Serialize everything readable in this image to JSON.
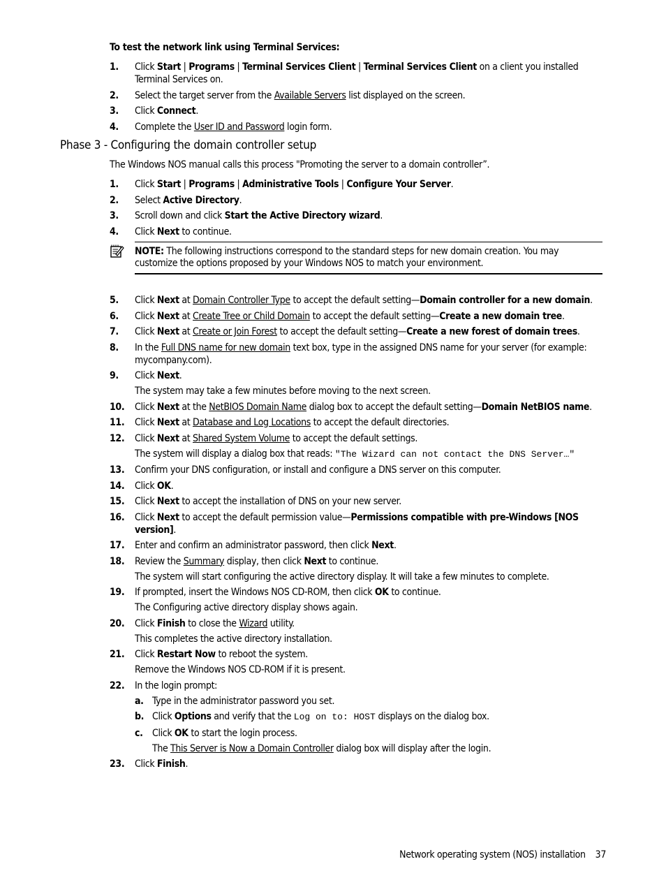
{
  "procedure_title": "To test the network link using Terminal Services:",
  "terminal_steps": [
    {
      "num": "1.",
      "paras": [
        [
          {
            "t": "Click "
          },
          {
            "t": "Start",
            "s": "b"
          },
          {
            "t": " | "
          },
          {
            "t": "Programs",
            "s": "b"
          },
          {
            "t": " | "
          },
          {
            "t": "Terminal Services Client",
            "s": "b"
          },
          {
            "t": " | "
          },
          {
            "t": "Terminal Services Client",
            "s": "b"
          },
          {
            "t": " on a client you installed Terminal Services on."
          }
        ]
      ]
    },
    {
      "num": "2.",
      "paras": [
        [
          {
            "t": "Select the target server from the "
          },
          {
            "t": "Available Servers",
            "s": "u"
          },
          {
            "t": " list displayed on the screen."
          }
        ]
      ]
    },
    {
      "num": "3.",
      "paras": [
        [
          {
            "t": "Click "
          },
          {
            "t": "Connect",
            "s": "b"
          },
          {
            "t": "."
          }
        ]
      ]
    },
    {
      "num": "4.",
      "paras": [
        [
          {
            "t": "Complete the "
          },
          {
            "t": "User ID and Password",
            "s": "u"
          },
          {
            "t": " login form."
          }
        ]
      ]
    }
  ],
  "section_heading": "Phase 3 - Configuring the domain controller setup",
  "intro": "The Windows NOS manual calls this process \"Promoting the server to a domain controller”.",
  "phase_steps_a": [
    {
      "num": "1.",
      "paras": [
        [
          {
            "t": "Click "
          },
          {
            "t": "Start",
            "s": "b"
          },
          {
            "t": " | "
          },
          {
            "t": "Programs",
            "s": "b"
          },
          {
            "t": " | "
          },
          {
            "t": "Administrative Tools",
            "s": "b"
          },
          {
            "t": " | "
          },
          {
            "t": "Configure Your Server",
            "s": "b"
          },
          {
            "t": "."
          }
        ]
      ]
    },
    {
      "num": "2.",
      "paras": [
        [
          {
            "t": "Select "
          },
          {
            "t": "Active Directory",
            "s": "b"
          },
          {
            "t": "."
          }
        ]
      ]
    },
    {
      "num": "3.",
      "paras": [
        [
          {
            "t": "Scroll down and click "
          },
          {
            "t": "Start the Active Directory wizard",
            "s": "b"
          },
          {
            "t": "."
          }
        ]
      ]
    },
    {
      "num": "4.",
      "paras": [
        [
          {
            "t": "Click "
          },
          {
            "t": "Next",
            "s": "b"
          },
          {
            "t": " to continue."
          }
        ]
      ]
    }
  ],
  "note": {
    "icon": "note-pad-icon",
    "label": "NOTE:",
    "text": " The following instructions correspond to the standard steps for new domain creation. You may customize the options proposed by your Windows NOS to match your environment."
  },
  "phase_steps_b": [
    {
      "num": "5.",
      "paras": [
        [
          {
            "t": "Click "
          },
          {
            "t": "Next",
            "s": "b"
          },
          {
            "t": " at "
          },
          {
            "t": "Domain Controller Type",
            "s": "u"
          },
          {
            "t": " to accept the default setting—"
          },
          {
            "t": "Domain controller for a new domain",
            "s": "b"
          },
          {
            "t": "."
          }
        ]
      ]
    },
    {
      "num": "6.",
      "paras": [
        [
          {
            "t": "Click "
          },
          {
            "t": "Next",
            "s": "b"
          },
          {
            "t": " at "
          },
          {
            "t": "Create Tree or Child Domain",
            "s": "u"
          },
          {
            "t": " to accept the default setting—"
          },
          {
            "t": "Create a new domain tree",
            "s": "b"
          },
          {
            "t": "."
          }
        ]
      ]
    },
    {
      "num": "7.",
      "paras": [
        [
          {
            "t": "Click "
          },
          {
            "t": "Next",
            "s": "b"
          },
          {
            "t": " at "
          },
          {
            "t": "Create or Join Forest",
            "s": "u"
          },
          {
            "t": " to accept the default setting—"
          },
          {
            "t": "Create a new forest of domain trees",
            "s": "b"
          },
          {
            "t": "."
          }
        ]
      ]
    },
    {
      "num": "8.",
      "paras": [
        [
          {
            "t": "In the "
          },
          {
            "t": "Full DNS name for new domain",
            "s": "u"
          },
          {
            "t": " text box, type in the assigned DNS name for your server (for example: mycompany.com)."
          }
        ]
      ]
    },
    {
      "num": "9.",
      "paras": [
        [
          {
            "t": "Click "
          },
          {
            "t": "Next",
            "s": "b"
          },
          {
            "t": "."
          }
        ],
        [
          {
            "t": "The system may take a few minutes before moving to the next screen."
          }
        ]
      ]
    },
    {
      "num": "10.",
      "paras": [
        [
          {
            "t": "Click "
          },
          {
            "t": "Next",
            "s": "b"
          },
          {
            "t": " at the "
          },
          {
            "t": "NetBIOS Domain Name",
            "s": "u"
          },
          {
            "t": " dialog box to accept the default setting—"
          },
          {
            "t": "Domain NetBIOS name",
            "s": "b"
          },
          {
            "t": "."
          }
        ]
      ]
    },
    {
      "num": "11.",
      "paras": [
        [
          {
            "t": "Click "
          },
          {
            "t": "Next",
            "s": "b"
          },
          {
            "t": " at "
          },
          {
            "t": "Database and Log Locations",
            "s": "u"
          },
          {
            "t": " to accept the default directories."
          }
        ]
      ]
    },
    {
      "num": "12.",
      "paras": [
        [
          {
            "t": "Click "
          },
          {
            "t": "Next",
            "s": "b"
          },
          {
            "t": " at "
          },
          {
            "t": "Shared System Volume",
            "s": "u"
          },
          {
            "t": " to accept the default settings."
          }
        ],
        [
          {
            "t": "The system will display a dialog box that reads: "
          },
          {
            "t": "\"The Wizard can not contact the DNS Server…\"",
            "s": "m"
          }
        ]
      ]
    },
    {
      "num": "13.",
      "paras": [
        [
          {
            "t": "Confirm your DNS configuration, or install and configure a DNS server on this computer."
          }
        ]
      ]
    },
    {
      "num": "14.",
      "paras": [
        [
          {
            "t": "Click "
          },
          {
            "t": "OK",
            "s": "b"
          },
          {
            "t": "."
          }
        ]
      ]
    },
    {
      "num": "15.",
      "paras": [
        [
          {
            "t": "Click "
          },
          {
            "t": "Next",
            "s": "b"
          },
          {
            "t": " to accept the installation of DNS on your new server."
          }
        ]
      ]
    },
    {
      "num": "16.",
      "paras": [
        [
          {
            "t": "Click "
          },
          {
            "t": "Next",
            "s": "b"
          },
          {
            "t": " to accept the default permission value—"
          },
          {
            "t": "Permissions compatible with pre-Windows [NOS version]",
            "s": "b"
          },
          {
            "t": "."
          }
        ]
      ]
    },
    {
      "num": "17.",
      "paras": [
        [
          {
            "t": "Enter and confirm an administrator password, then click "
          },
          {
            "t": "Next",
            "s": "b"
          },
          {
            "t": "."
          }
        ]
      ]
    },
    {
      "num": "18.",
      "paras": [
        [
          {
            "t": "Review the "
          },
          {
            "t": "Summary",
            "s": "u"
          },
          {
            "t": " display, then click "
          },
          {
            "t": "Next",
            "s": "b"
          },
          {
            "t": " to continue."
          }
        ],
        [
          {
            "t": "The system will start configuring the active directory display. It will take a few minutes to complete."
          }
        ]
      ]
    },
    {
      "num": "19.",
      "paras": [
        [
          {
            "t": "If prompted, insert the Windows NOS CD-ROM, then click "
          },
          {
            "t": "OK",
            "s": "b"
          },
          {
            "t": " to continue."
          }
        ],
        [
          {
            "t": "The Configuring active directory display shows again."
          }
        ]
      ]
    },
    {
      "num": "20.",
      "paras": [
        [
          {
            "t": "Click "
          },
          {
            "t": "Finish",
            "s": "b"
          },
          {
            "t": " to close the "
          },
          {
            "t": "Wizard",
            "s": "u"
          },
          {
            "t": " utility."
          }
        ],
        [
          {
            "t": "This completes the active directory installation."
          }
        ]
      ]
    },
    {
      "num": "21.",
      "paras": [
        [
          {
            "t": "Click "
          },
          {
            "t": "Restart Now",
            "s": "b"
          },
          {
            "t": " to reboot the system."
          }
        ],
        [
          {
            "t": "Remove the Windows NOS CD-ROM if it is present."
          }
        ]
      ]
    },
    {
      "num": "22.",
      "paras": [
        [
          {
            "t": "In the login prompt:"
          }
        ]
      ],
      "substeps": [
        {
          "num": "a.",
          "paras": [
            [
              {
                "t": "Type in the administrator password you set."
              }
            ]
          ]
        },
        {
          "num": "b.",
          "paras": [
            [
              {
                "t": "Click "
              },
              {
                "t": "Options",
                "s": "b"
              },
              {
                "t": " and verify that the "
              },
              {
                "t": "Log on to: HOST",
                "s": "m"
              },
              {
                "t": " displays on the dialog box."
              }
            ]
          ]
        },
        {
          "num": "c.",
          "paras": [
            [
              {
                "t": "Click "
              },
              {
                "t": "OK",
                "s": "b"
              },
              {
                "t": " to start the login process."
              }
            ],
            [
              {
                "t": "The "
              },
              {
                "t": "This Server is Now a Domain Controller",
                "s": "u"
              },
              {
                "t": " dialog box will display after the login."
              }
            ]
          ]
        }
      ]
    },
    {
      "num": "23.",
      "paras": [
        [
          {
            "t": "Click "
          },
          {
            "t": "Finish",
            "s": "b"
          },
          {
            "t": "."
          }
        ]
      ]
    }
  ],
  "footer": {
    "section": "Network operating system (NOS) installation",
    "page": "37"
  }
}
